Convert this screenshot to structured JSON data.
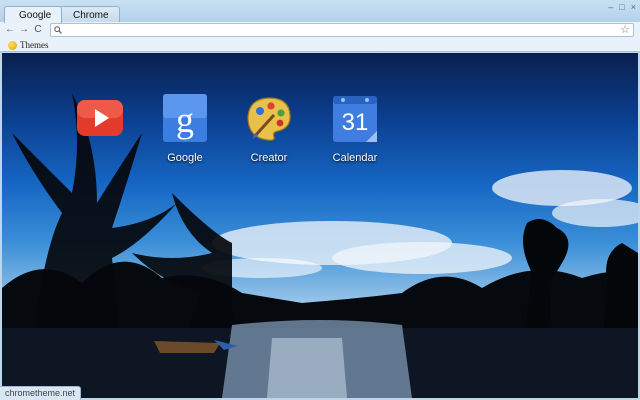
{
  "tabs": [
    {
      "label": "Google",
      "active": true
    },
    {
      "label": "Chrome",
      "active": false
    }
  ],
  "window_controls": [
    "–",
    "□",
    "×"
  ],
  "toolbar": {
    "back": "←",
    "forward": "→",
    "reload": "C",
    "omnibox_value": "",
    "star": "☆"
  },
  "bookmarks": [
    {
      "label": "Themes",
      "icon": "theme-icon"
    }
  ],
  "apps": [
    {
      "label": "",
      "icon": "youtube-icon",
      "color": "#e43b2c"
    },
    {
      "label": "Google",
      "icon": "google-search-icon",
      "color": "#3b7de0"
    },
    {
      "label": "Creator",
      "icon": "palette-icon",
      "color": "#e8c14a"
    },
    {
      "label": "Calendar",
      "icon": "calendar-icon",
      "color": "#3f7ee0",
      "day": "31"
    }
  ],
  "status": {
    "text": "chrometheme.net"
  }
}
